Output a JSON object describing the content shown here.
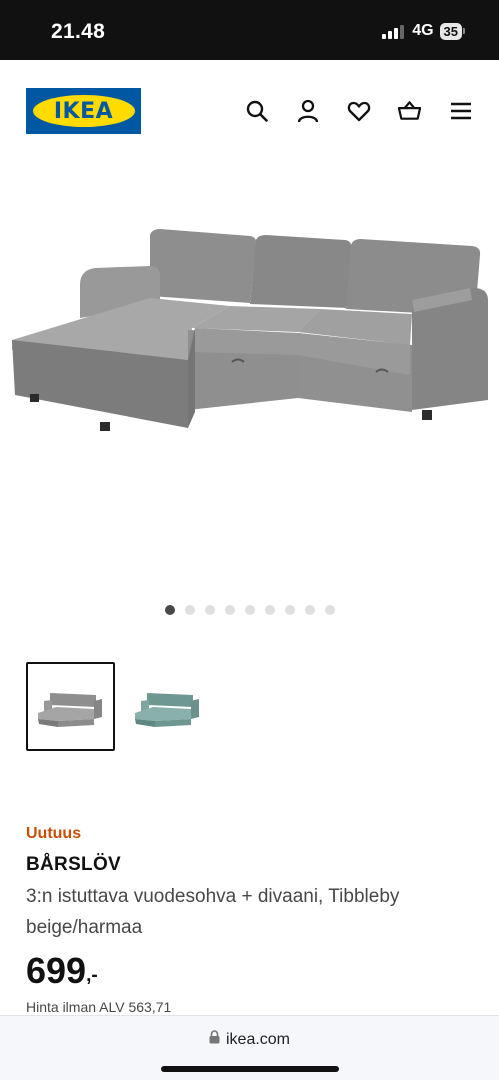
{
  "status": {
    "time": "21.48",
    "network": "4G",
    "battery": "35"
  },
  "header": {
    "logo_text": "IKEA",
    "icons": [
      "search-icon",
      "user-icon",
      "heart-icon",
      "basket-icon",
      "menu-icon"
    ]
  },
  "gallery": {
    "total_images": 9,
    "active_index": 0
  },
  "thumbnails": [
    {
      "variant": "grey",
      "selected": true
    },
    {
      "variant": "turquoise",
      "selected": false
    }
  ],
  "product": {
    "badge": "Uutuus",
    "name": "BÅRSLÖV",
    "description": "3:n istuttava vuodesohva + divaani, Tibbleby beige/harmaa",
    "price_int": "699",
    "price_dec": ",-",
    "vat_text": "Hinta ilman ALV 563,71"
  },
  "browser": {
    "url": "ikea.com"
  },
  "colors": {
    "ikea_blue": "#0058a3",
    "ikea_yellow": "#ffdb00",
    "badge_orange": "#ca5008",
    "sofa_grey": "#8a8a8a",
    "sofa_turquoise": "#7fa5a0"
  }
}
